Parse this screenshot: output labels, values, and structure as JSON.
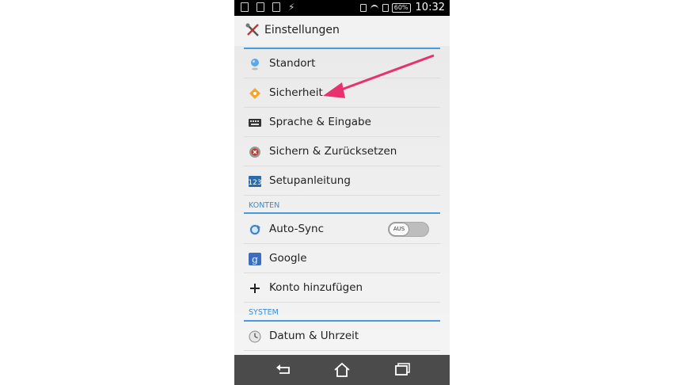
{
  "status_bar": {
    "battery": "60%",
    "time": "10:32"
  },
  "app_bar": {
    "title": "Einstellungen"
  },
  "items_top": [
    {
      "label": "Standort",
      "icon": "location-icon"
    },
    {
      "label": "Sicherheit",
      "icon": "lock-icon"
    },
    {
      "label": "Sprache & Eingabe",
      "icon": "keyboard-icon"
    },
    {
      "label": "Sichern & Zurücksetzen",
      "icon": "backup-icon"
    },
    {
      "label": "Setupanleitung",
      "icon": "setup-guide-icon"
    }
  ],
  "sections": {
    "accounts": "KONTEN",
    "system": "SYSTEM"
  },
  "accounts": [
    {
      "label": "Auto-Sync",
      "icon": "sync-icon",
      "toggle": "AUS"
    },
    {
      "label": "Google",
      "icon": "google-icon"
    },
    {
      "label": "Konto hinzufügen",
      "icon": "plus-icon"
    }
  ],
  "system": [
    {
      "label": "Datum & Uhrzeit",
      "icon": "clock-icon"
    }
  ],
  "colors": {
    "accent": "#4a9ad8",
    "arrow": "#e8316f",
    "navbar": "#4b4b4b"
  }
}
